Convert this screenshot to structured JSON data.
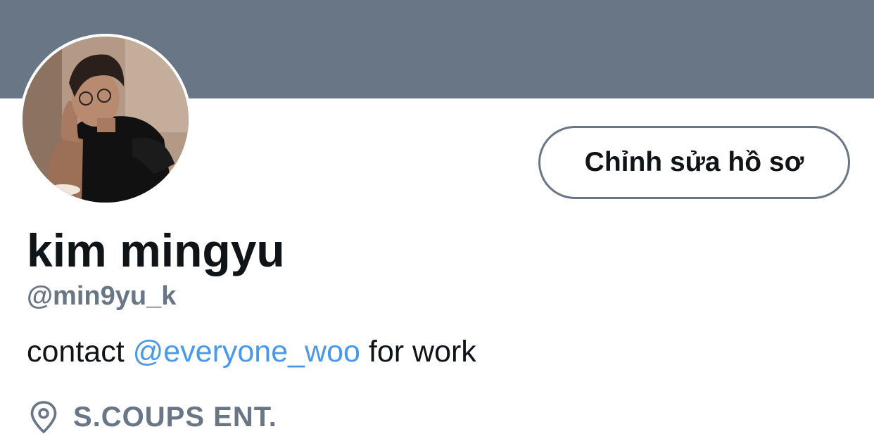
{
  "profile": {
    "display_name": "kim mingyu",
    "handle": "@min9yu_k",
    "edit_button_label": "Chỉnh sửa hồ sơ",
    "bio": {
      "prefix": "contact ",
      "mention": "@everyone_woo",
      "suffix": " for work"
    },
    "location": "S.COUPS ENT.",
    "location_icon": "location-pin-icon",
    "avatar_alt": "avatar"
  },
  "colors": {
    "banner": "#687686",
    "link": "#4a99e9",
    "text_primary": "#0f1419",
    "text_secondary": "#687686"
  }
}
